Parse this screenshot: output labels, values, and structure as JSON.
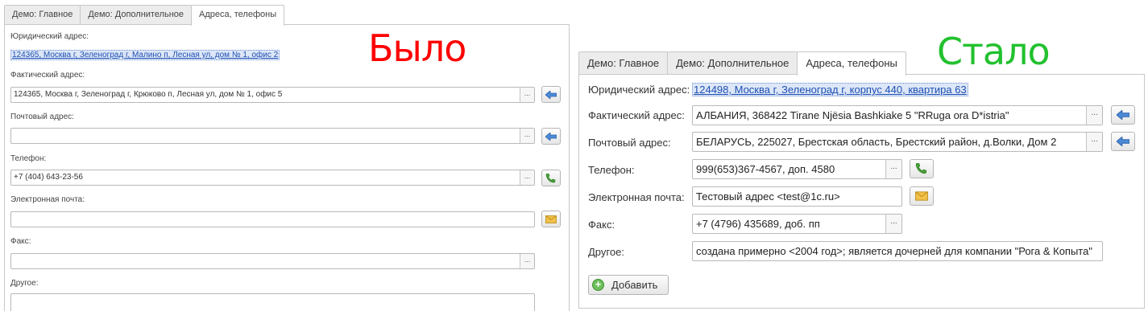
{
  "before": {
    "title": "Было",
    "tabs": [
      "Демо: Главное",
      "Демо: Дополнительное",
      "Адреса, телефоны"
    ],
    "legal_address": {
      "label": "Юридический адрес:",
      "value": "124365, Москва г, Зеленоград г, Малино п, Лесная ул, дом № 1, офис 2"
    },
    "actual_address": {
      "label": "Фактический адрес:",
      "value": "124365, Москва г, Зеленоград г, Крюково п, Лесная ул, дом № 1, офис 5"
    },
    "postal_address": {
      "label": "Почтовый адрес:",
      "value": ""
    },
    "phone": {
      "label": "Телефон:",
      "value": "+7 (404) 643-23-56"
    },
    "email": {
      "label": "Электронная почта:",
      "value": ""
    },
    "fax": {
      "label": "Факс:",
      "value": ""
    },
    "other": {
      "label": "Другое:",
      "value": ""
    },
    "select_button_label": "..."
  },
  "after": {
    "title": "Стало",
    "tabs": [
      "Демо: Главное",
      "Демо: Дополнительное",
      "Адреса, телефоны"
    ],
    "legal_address": {
      "label": "Юридический адрес:",
      "value": "124498, Москва г, Зеленоград г, корпус 440, квартира 63"
    },
    "actual_address": {
      "label": "Фактический адрес:",
      "value": "АЛБАНИЯ, 368422 Tirane Një​sia  Bashkiake 5 \"RRuga ora D*istria\""
    },
    "postal_address": {
      "label": "Почтовый адрес:",
      "value": "БЕЛАРУСЬ,  225027,  Брестская область,  Брестский район,  д.Волки,  Дом 2"
    },
    "phone": {
      "label": "Телефон:",
      "value": "999(653)367-4567, доп. 4580"
    },
    "email": {
      "label": "Электронная почта:",
      "value": "Тестовый адрес <test@1c.ru>"
    },
    "fax": {
      "label": "Факс:",
      "value": "+7 (4796) 435689, доб. пп"
    },
    "other": {
      "label": "Другое:",
      "value": "создана примерно <2004 год>; является дочерней для компании \"Рога & Копыта\""
    },
    "add_button_label": "Добавить",
    "select_button_label": "..."
  },
  "colors": {
    "title_before": "#ff0000",
    "title_after": "#22c12e",
    "link": "#1f4fb4"
  },
  "icons": {
    "copy_address": "arrow-left-icon",
    "phone": "phone-icon",
    "email": "envelope-icon",
    "add": "plus-circle-icon"
  }
}
